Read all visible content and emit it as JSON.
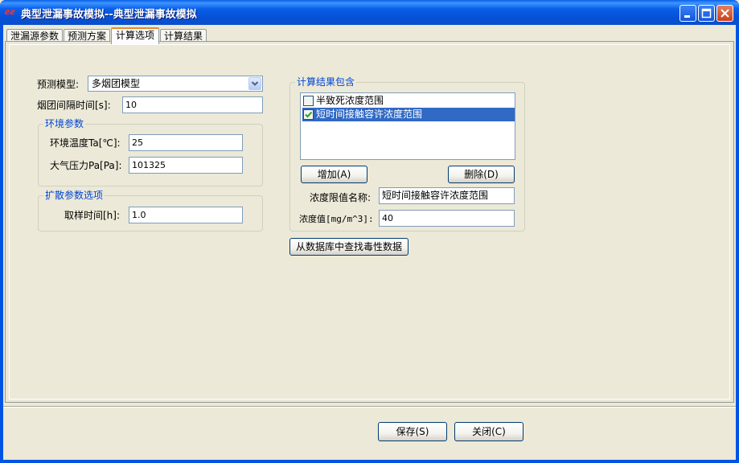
{
  "window": {
    "title": "典型泄漏事故模拟--典型泄漏事故模拟",
    "icon": "app-icon",
    "colors": {
      "titlebar": "#0A5FE8",
      "face": "#ECE9D8",
      "selection": "#316AC5",
      "group_title": "#0046D5"
    }
  },
  "tabs": [
    {
      "label": "泄漏源参数"
    },
    {
      "label": "预测方案"
    },
    {
      "label": "计算选项",
      "active": true
    },
    {
      "label": "计算结果"
    }
  ],
  "model": {
    "label": "预测模型:",
    "selected": "多烟团模型"
  },
  "interval": {
    "label": "烟团间隔时间[s]:",
    "value": "10"
  },
  "env_group": {
    "title": "环境参数",
    "temp_label": "环境温度Ta[℃]:",
    "temp_value": "25",
    "pressure_label": "大气压力Pa[Pa]:",
    "pressure_value": "101325"
  },
  "diff_group": {
    "title": "扩散参数选项",
    "sampling_label": "取样时间[h]:",
    "sampling_value": "1.0"
  },
  "results_group": {
    "title": "计算结果包含",
    "items": [
      {
        "label": "半致死浓度范围",
        "checked": false,
        "selected": false
      },
      {
        "label": "短时间接触容许浓度范围",
        "checked": true,
        "selected": true
      }
    ],
    "add_button": "增加(A)",
    "delete_button": "删除(D)",
    "limit_name_label": "浓度限值名称:",
    "limit_name_value": "短时间接触容许浓度范围",
    "conc_label": "浓度值[mg/m^3]:",
    "conc_value": "40"
  },
  "db_button": "从数据库中查找毒性数据",
  "footer": {
    "save_button": "保存(S)",
    "close_button": "关闭(C)"
  }
}
